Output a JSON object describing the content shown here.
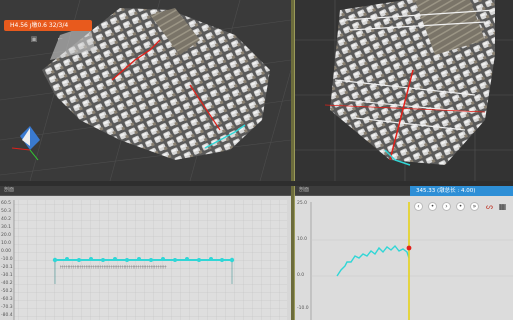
{
  "top_left": {
    "title": "",
    "status_badge": "H4.56 ȷ墩0.6  32/3/4",
    "tools": [
      "camera-icon",
      "ruler-icon"
    ]
  },
  "bottom_left": {
    "title": "剖面",
    "y_labels": [
      "60.5",
      "50.3",
      "40.2",
      "30.1",
      "20.0",
      "10.0",
      "0.00",
      "-10.0",
      "-20.1",
      "-30.1",
      "-40.2",
      "-50.2",
      "-60.3",
      "-70.3",
      "-80.4"
    ]
  },
  "bottom_right": {
    "title": "剖面",
    "axis_tag": "345.33 (墩总长 : 4.00)",
    "y_labels": [
      "25.0",
      "10.0",
      "0.0",
      "-10.0"
    ],
    "controls": [
      "prev",
      "play",
      "next",
      "stop",
      "end"
    ],
    "side_icons": [
      "chart-line-icon",
      "grid-icon"
    ]
  },
  "colors": {
    "accent_orange": "#e85a1d",
    "accent_blue": "#2e8fd6",
    "profile_cyan": "#30d6d6",
    "cursor_yellow": "#e6d21a",
    "marker_red": "#e0201a"
  }
}
